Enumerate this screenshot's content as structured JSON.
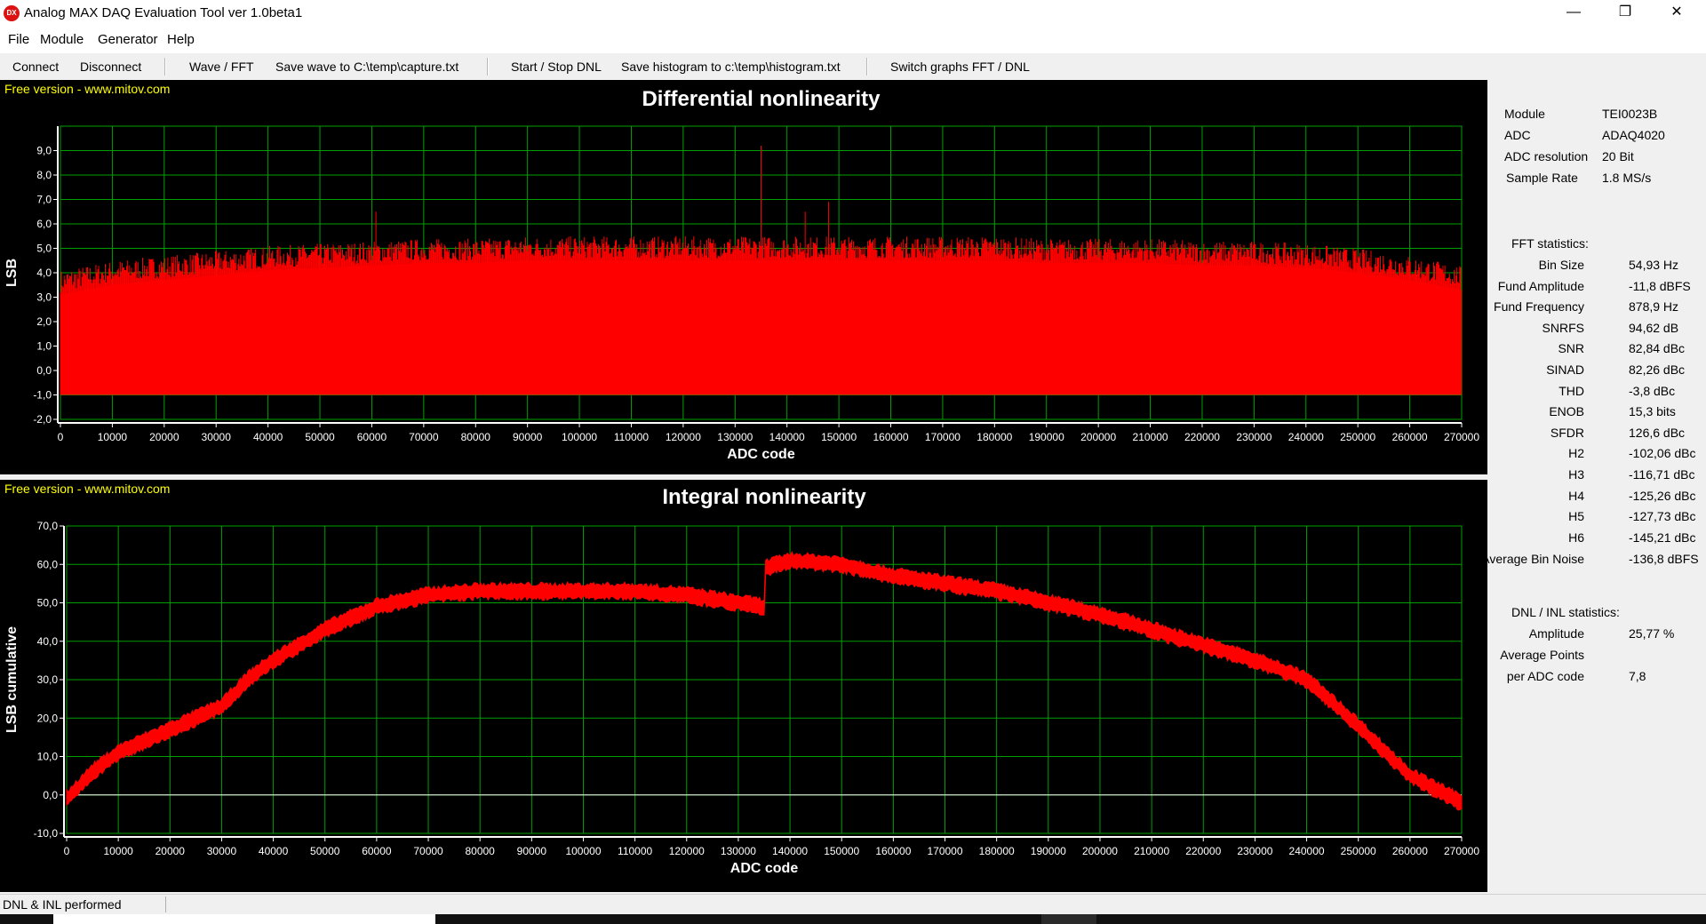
{
  "window": {
    "title": "Analog MAX DAQ Evaluation Tool ver 1.0beta1",
    "app_icon": "DX",
    "minimize": "—",
    "restore": "❐",
    "close": "✕"
  },
  "menu": [
    "File",
    "Module",
    "Generator",
    "Help"
  ],
  "toolbar": [
    "Connect",
    "Disconnect",
    "Wave / FFT",
    "Save wave to C:\\temp\\capture.txt",
    "Start / Stop DNL",
    "Save histogram to c:\\temp\\histogram.txt",
    "Switch graphs FFT / DNL"
  ],
  "watermark": "Free version - www.mitov.com",
  "chart_data": [
    {
      "type": "bar",
      "title": "Differential nonlinearity",
      "xlabel": "ADC code",
      "ylabel": "LSB",
      "xlim": [
        0,
        270000
      ],
      "ylim": [
        -2.0,
        10.0
      ],
      "xticks": [
        0,
        10000,
        20000,
        30000,
        40000,
        50000,
        60000,
        70000,
        80000,
        90000,
        100000,
        110000,
        120000,
        130000,
        140000,
        150000,
        160000,
        170000,
        180000,
        190000,
        200000,
        210000,
        220000,
        230000,
        240000,
        250000,
        260000,
        270000
      ],
      "yticks": [
        "-2,0",
        "-1,0",
        "0,0",
        "1,0",
        "2,0",
        "3,0",
        "4,0",
        "5,0",
        "6,0",
        "7,0",
        "8,0",
        "9,0"
      ],
      "ytick_values": [
        -2,
        -1,
        0,
        1,
        2,
        3,
        4,
        5,
        6,
        7,
        8,
        9
      ],
      "grid": true,
      "color": "#ff0000",
      "baseline": -1.0,
      "x": [
        0,
        10000,
        20000,
        30000,
        40000,
        50000,
        60000,
        70000,
        80000,
        90000,
        100000,
        110000,
        120000,
        130000,
        140000,
        150000,
        160000,
        170000,
        180000,
        190000,
        200000,
        210000,
        220000,
        230000,
        240000,
        250000,
        260000,
        270000
      ],
      "y_envelope_top": [
        3.8,
        4.2,
        4.4,
        4.6,
        4.8,
        4.9,
        5.0,
        5.1,
        5.1,
        5.2,
        5.2,
        5.2,
        5.2,
        5.2,
        5.2,
        5.2,
        5.2,
        5.2,
        5.2,
        5.1,
        5.1,
        5.1,
        5.0,
        5.0,
        4.9,
        4.7,
        4.4,
        4.0
      ],
      "spikes": [
        [
          60800,
          6.5
        ],
        [
          135000,
          9.2
        ],
        [
          143500,
          6.5
        ],
        [
          148000,
          6.9
        ]
      ]
    },
    {
      "type": "area",
      "title": "Integral nonlinearity",
      "xlabel": "ADC code",
      "ylabel": "LSB cumulative",
      "xlim": [
        0,
        270000
      ],
      "ylim": [
        -10.0,
        70.0
      ],
      "xticks": [
        0,
        10000,
        20000,
        30000,
        40000,
        50000,
        60000,
        70000,
        80000,
        90000,
        100000,
        110000,
        120000,
        130000,
        140000,
        150000,
        160000,
        170000,
        180000,
        190000,
        200000,
        210000,
        220000,
        230000,
        240000,
        250000,
        260000,
        270000
      ],
      "yticks": [
        "-10,0",
        "0,0",
        "10,0",
        "20,0",
        "30,0",
        "40,0",
        "50,0",
        "60,0",
        "70,0"
      ],
      "ytick_values": [
        -10,
        0,
        10,
        20,
        30,
        40,
        50,
        60,
        70
      ],
      "grid": true,
      "color": "#ff0000",
      "x": [
        0,
        5000,
        10000,
        20000,
        30000,
        35000,
        40000,
        50000,
        60000,
        70000,
        80000,
        90000,
        100000,
        110000,
        120000,
        130000,
        135000,
        135100,
        140000,
        150000,
        160000,
        170000,
        180000,
        190000,
        200000,
        210000,
        220000,
        230000,
        240000,
        250000,
        260000,
        270000
      ],
      "y": [
        -1,
        6,
        11,
        17,
        23,
        30,
        35,
        43,
        49,
        52,
        53,
        53,
        53,
        53,
        52,
        50,
        49,
        59,
        61,
        60,
        57,
        55,
        53,
        50,
        47,
        43,
        39,
        35,
        30,
        18,
        5,
        -2
      ],
      "band_width": 4.0
    }
  ],
  "stats": {
    "module": {
      "label": "Module",
      "value": "TEI0023B"
    },
    "adc": {
      "label": "ADC",
      "value": "ADAQ4020"
    },
    "resolution": {
      "label": "ADC resolution",
      "value": "20 Bit"
    },
    "sample_rate": {
      "label": "Sample Rate",
      "value": "1.8 MS/s"
    },
    "fft_header": "FFT statistics:",
    "fft": [
      {
        "label": "Bin Size",
        "value": "54,93 Hz"
      },
      {
        "label": "Fund Amplitude",
        "value": "-11,8 dBFS"
      },
      {
        "label": "Fund Frequency",
        "value": "878,9 Hz"
      },
      {
        "label": "SNRFS",
        "value": "94,62 dB"
      },
      {
        "label": "SNR",
        "value": "82,84 dBc"
      },
      {
        "label": "SINAD",
        "value": "82,26 dBc"
      },
      {
        "label": "THD",
        "value": "-3,8 dBc"
      },
      {
        "label": "ENOB",
        "value": "15,3 bits"
      },
      {
        "label": "SFDR",
        "value": "126,6 dBc"
      },
      {
        "label": "H2",
        "value": "-102,06 dBc"
      },
      {
        "label": "H3",
        "value": "-116,71 dBc"
      },
      {
        "label": "H4",
        "value": "-125,26 dBc"
      },
      {
        "label": "H5",
        "value": "-127,73 dBc"
      },
      {
        "label": "H6",
        "value": "-145,21 dBc"
      }
    ],
    "avg_bin_noise": {
      "label": "Average Bin Noise",
      "value": "-136,8 dBFS"
    },
    "dnl_header": "DNL / INL statistics:",
    "amplitude": {
      "label": "Amplitude",
      "value": "25,77 %"
    },
    "avg_points_1": "Average Points",
    "avg_points_2": {
      "label": "per ADC code",
      "value": "7,8"
    }
  },
  "status": {
    "text": "DNL & INL performed"
  }
}
